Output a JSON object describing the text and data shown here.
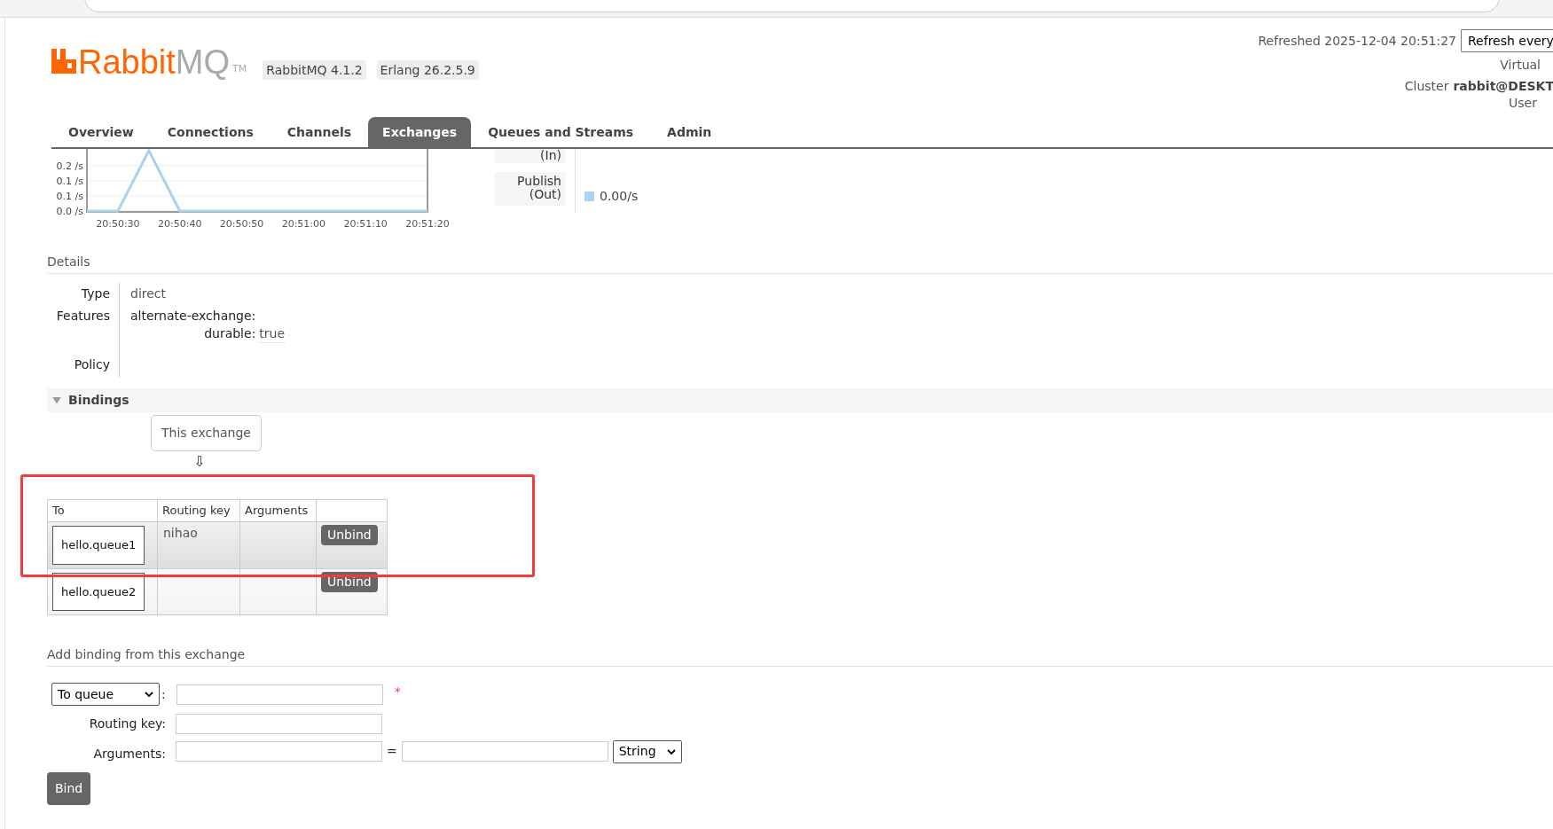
{
  "logo": {
    "rabbit": "Rabbit",
    "mq": "MQ",
    "tm": "TM"
  },
  "versions": [
    "RabbitMQ 4.1.2",
    "Erlang 26.2.5.9"
  ],
  "header_right": {
    "refreshed": "Refreshed 2025-12-04 20:51:27",
    "refresh_select": "Refresh every",
    "virtual": "Virtual",
    "cluster_label": "Cluster",
    "cluster_value": "rabbit@DESKT",
    "user_label": "User"
  },
  "tabs": [
    {
      "label": "Overview",
      "selected": false
    },
    {
      "label": "Connections",
      "selected": false
    },
    {
      "label": "Channels",
      "selected": false
    },
    {
      "label": "Exchanges",
      "selected": true
    },
    {
      "label": "Queues and Streams",
      "selected": false
    },
    {
      "label": "Admin",
      "selected": false
    }
  ],
  "chart_data": {
    "type": "line",
    "categories": [
      null,
      "20:50:30",
      null,
      "20:50:40",
      null,
      "20:50:50",
      null,
      "20:51:00",
      null,
      "20:51:10",
      null,
      "20:51:20"
    ],
    "series": [
      {
        "color": "#acd3e6",
        "values": [
          0,
          0,
          0.2,
          0,
          0,
          0,
          0,
          0,
          0,
          0,
          0,
          0
        ]
      }
    ],
    "ylim": [
      0,
      0.22
    ],
    "grid": true,
    "yticks": [
      {
        "value": 0,
        "label": "0.0 /s"
      },
      {
        "value": 0.05,
        "label": "0.1 /s"
      },
      {
        "value": 0.1,
        "label": "0.1 /s"
      },
      {
        "value": 0.15,
        "label": "0.2 /s"
      }
    ]
  },
  "legend": [
    {
      "label": "(In)"
    },
    {
      "label": "Publish (Out)",
      "value": "0.00/s",
      "color": "#aad4f5"
    }
  ],
  "details": {
    "title": "Details",
    "rows": [
      {
        "kind": "text",
        "label": "Type",
        "value": "direct"
      },
      {
        "kind": "features",
        "label": "Features",
        "items": [
          {
            "key": "alternate-exchange:",
            "value": null
          },
          {
            "key": "durable:",
            "value": "true"
          }
        ]
      },
      {
        "kind": "text",
        "label": "Policy",
        "value": null
      }
    ]
  },
  "bindings": {
    "title": "Bindings",
    "expanded": true,
    "source": "This exchange",
    "arrow": "⇩",
    "columns": [
      "To",
      "Routing key",
      "Arguments"
    ],
    "rows": [
      {
        "to": "hello.queue1",
        "routing_key": "nihao",
        "action": "Unbind"
      },
      {
        "to": "hello.queue2",
        "routing_key": null,
        "action": "Unbind"
      }
    ]
  },
  "add_binding": {
    "title": "Add binding from this exchange",
    "destination_select": "To queue",
    "colon": ":",
    "required_mark": "*",
    "routing_key_label": "Routing key:",
    "arguments_label": "Arguments:",
    "equals": "=",
    "type_select": "String",
    "button": "Bind"
  }
}
